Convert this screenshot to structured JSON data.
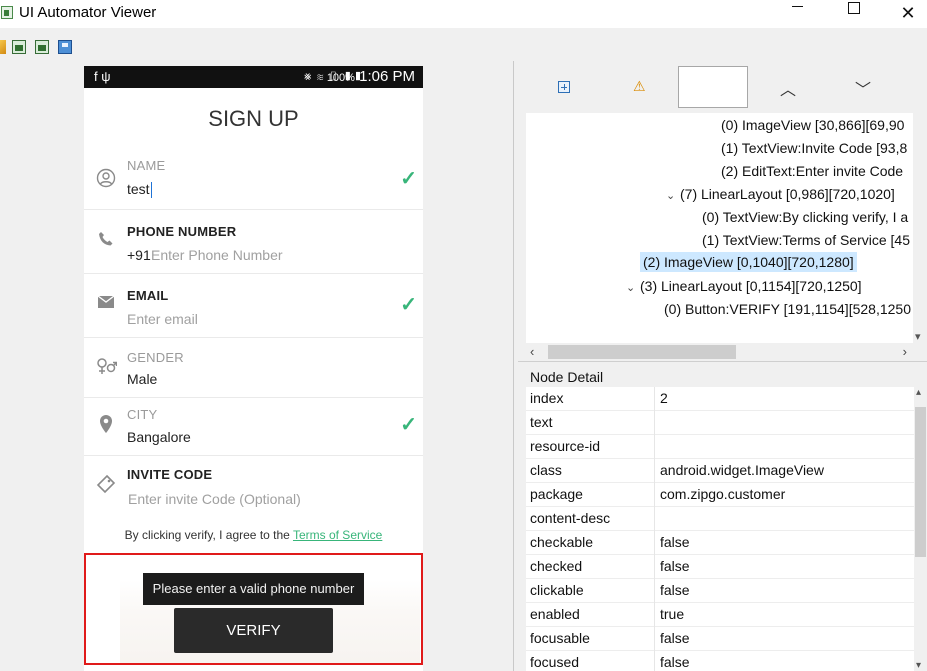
{
  "window": {
    "title": "UI Automator Viewer",
    "controls": {
      "minimize": "",
      "maximize": "",
      "close": "✕"
    }
  },
  "toolbar": {
    "icons": [
      "open-icon",
      "device-screenshot-icon",
      "device-screenshot-compressed-icon",
      "save-icon"
    ]
  },
  "device": {
    "statusbar": {
      "left_icons": "f  ψ",
      "mid_icons": "⨳ ≋ ▯ ▮▮",
      "battery": "100%",
      "time": "1:06 PM"
    },
    "title": "SIGN UP",
    "fields": {
      "name": {
        "label": "NAME",
        "value": "test"
      },
      "phone": {
        "label": "PHONE NUMBER",
        "prefix": "+91",
        "placeholder": "Enter Phone Number"
      },
      "email": {
        "label": "EMAIL",
        "placeholder": "Enter email"
      },
      "gender": {
        "label": "GENDER",
        "value": "Male"
      },
      "city": {
        "label": "CITY",
        "value": "Bangalore"
      },
      "invite": {
        "label": "INVITE CODE",
        "placeholder": "Enter invite Code (Optional)"
      }
    },
    "terms": {
      "text": "By clicking verify, I agree to the ",
      "link": "Terms of Service"
    },
    "tooltip": "Please enter a valid phone number",
    "verify_button": "VERIFY",
    "colors": {
      "accent": "#38b57a",
      "highlight": "#e01a1a"
    }
  },
  "tree": {
    "rows": [
      "(0) ImageView [30,866][69,90",
      "(1) TextView:Invite Code [93,8",
      "(2) EditText:Enter invite Code",
      "(7) LinearLayout [0,986][720,1020]",
      "(0) TextView:By clicking verify, I a",
      "(1) TextView:Terms of Service [45",
      "(2) ImageView [0,1040][720,1280]",
      "(3) LinearLayout [0,1154][720,1250]",
      "(0) Button:VERIFY [191,1154][528,1250"
    ],
    "selected_index": 6
  },
  "node_detail": {
    "title": "Node Detail",
    "rows": [
      {
        "key": "index",
        "value": "2"
      },
      {
        "key": "text",
        "value": ""
      },
      {
        "key": "resource-id",
        "value": ""
      },
      {
        "key": "class",
        "value": "android.widget.ImageView"
      },
      {
        "key": "package",
        "value": "com.zipgo.customer"
      },
      {
        "key": "content-desc",
        "value": ""
      },
      {
        "key": "checkable",
        "value": "false"
      },
      {
        "key": "checked",
        "value": "false"
      },
      {
        "key": "clickable",
        "value": "false"
      },
      {
        "key": "enabled",
        "value": "true"
      },
      {
        "key": "focusable",
        "value": "false"
      },
      {
        "key": "focused",
        "value": "false"
      }
    ]
  }
}
